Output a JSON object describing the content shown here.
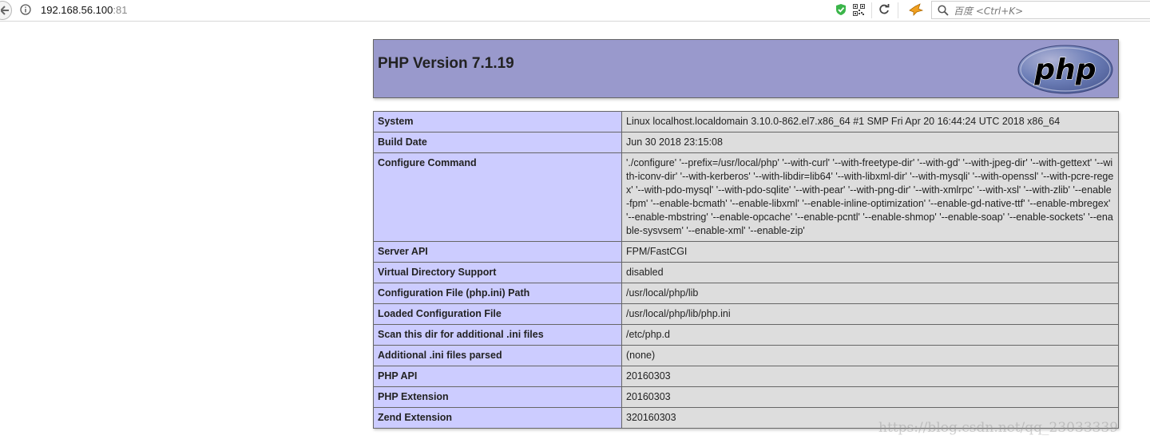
{
  "browser": {
    "url_host": "192.168.56.100",
    "url_port": ":81",
    "search_placeholder": "百度 <Ctrl+K>"
  },
  "header": {
    "title": "PHP Version 7.1.19",
    "logo_text": "php"
  },
  "rows": [
    {
      "label": "System",
      "value": "Linux localhost.localdomain 3.10.0-862.el7.x86_64 #1 SMP Fri Apr 20 16:44:24 UTC 2018 x86_64"
    },
    {
      "label": "Build Date",
      "value": "Jun 30 2018 23:15:08"
    },
    {
      "label": "Configure Command",
      "value": "'./configure' '--prefix=/usr/local/php' '--with-curl' '--with-freetype-dir' '--with-gd' '--with-jpeg-dir' '--with-gettext' '--with-iconv-dir' '--with-kerberos' '--with-libdir=lib64' '--with-libxml-dir' '--with-mysqli' '--with-openssl' '--with-pcre-regex' '--with-pdo-mysql' '--with-pdo-sqlite' '--with-pear' '--with-png-dir' '--with-xmlrpc' '--with-xsl' '--with-zlib' '--enable-fpm' '--enable-bcmath' '--enable-libxml' '--enable-inline-optimization' '--enable-gd-native-ttf' '--enable-mbregex' '--enable-mbstring' '--enable-opcache' '--enable-pcntl' '--enable-shmop' '--enable-soap' '--enable-sockets' '--enable-sysvsem' '--enable-xml' '--enable-zip'"
    },
    {
      "label": "Server API",
      "value": "FPM/FastCGI"
    },
    {
      "label": "Virtual Directory Support",
      "value": "disabled"
    },
    {
      "label": "Configuration File (php.ini) Path",
      "value": "/usr/local/php/lib"
    },
    {
      "label": "Loaded Configuration File",
      "value": "/usr/local/php/lib/php.ini"
    },
    {
      "label": "Scan this dir for additional .ini files",
      "value": "/etc/php.d"
    },
    {
      "label": "Additional .ini files parsed",
      "value": "(none)"
    },
    {
      "label": "PHP API",
      "value": "20160303"
    },
    {
      "label": "PHP Extension",
      "value": "20160303"
    },
    {
      "label": "Zend Extension",
      "value": "320160303"
    }
  ],
  "watermark": "https://blog.csdn.net/qq_23033339",
  "colors": {
    "header_bg": "#9999cc",
    "label_bg": "#ccccff",
    "value_bg": "#dddddd"
  }
}
